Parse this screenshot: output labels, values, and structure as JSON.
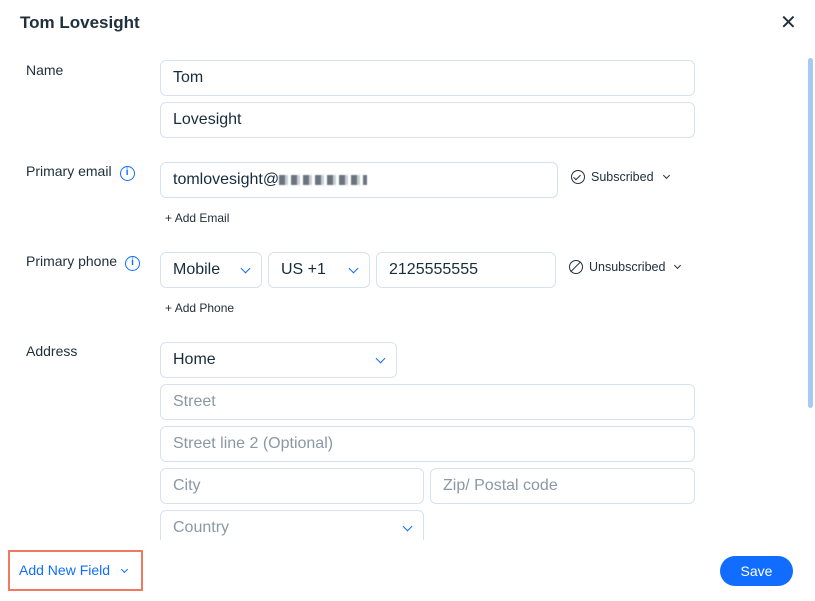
{
  "dialog": {
    "title": "Tom Lovesight",
    "close_icon": "close-icon"
  },
  "name": {
    "label": "Name",
    "first": "Tom",
    "last": "Lovesight"
  },
  "email": {
    "label": "Primary email",
    "value": "tomlovesight@",
    "status": "Subscribed",
    "add": "Add Email"
  },
  "phone": {
    "label": "Primary phone",
    "type": "Mobile",
    "country": "US +1",
    "number": "2125555555",
    "status": "Unsubscribed",
    "add": "Add Phone"
  },
  "address": {
    "label": "Address",
    "type": "Home",
    "street_placeholder": "Street",
    "street2_placeholder": "Street line 2 (Optional)",
    "city_placeholder": "City",
    "zip_placeholder": "Zip/ Postal code",
    "country_placeholder": "Country"
  },
  "footer": {
    "add_field": "Add New Field",
    "save": "Save"
  },
  "colors": {
    "accent": "#116dff",
    "highlight": "#f07a5f"
  }
}
